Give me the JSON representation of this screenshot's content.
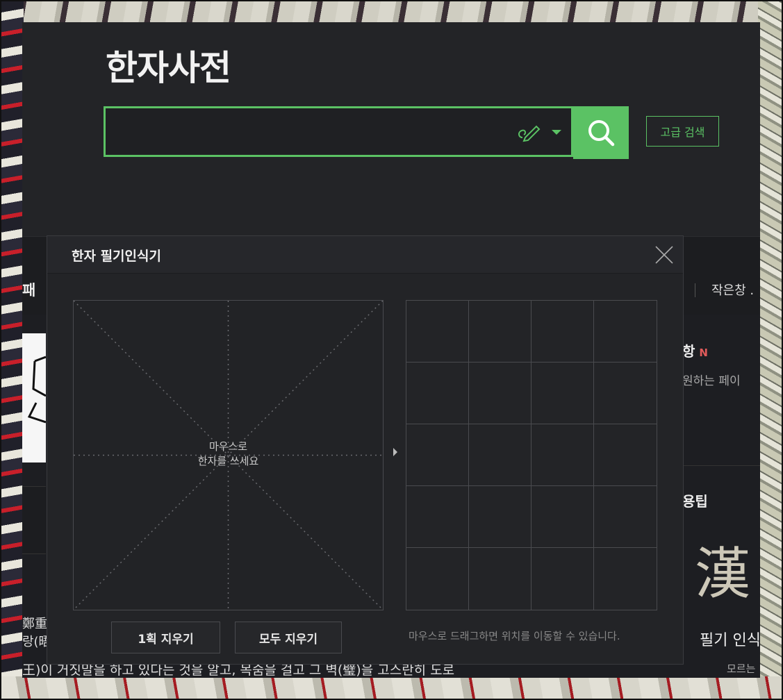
{
  "header": {
    "logo": "한자사전",
    "search": {
      "value": "",
      "placeholder": ""
    },
    "advanced_search_label": "고급 검색"
  },
  "nav": {
    "left_partial": "패",
    "small_window": "작은창 ."
  },
  "sidebar": {
    "notice_title": "항",
    "notice_badge": "N",
    "notice_text": "원하는 페이",
    "tips_title": "용팁",
    "big_hanja": "漢",
    "handwriting_title": "필기 인식",
    "handwriting_sub": "모르는"
  },
  "article": {
    "line1": "鄭重",
    "line2": "랑(晤",
    "line3": "王)이 거짓말을 하고 있다는 것을 알고, 목숨을 걸고 그 벽(璧)을 고스란히 도로"
  },
  "dialog": {
    "title": "한자 필기인식기",
    "pad_hint_line1": "마우스로",
    "pad_hint_line2": "한자를 쓰세요",
    "undo_label": "1획 지우기",
    "clear_label": "모두 지우기",
    "drag_hint": "마우스로 드래그하면 위치를 이동할 수 있습니다.",
    "result_cells": 20
  },
  "colors": {
    "accent": "#5bc264",
    "background": "#1d1e22",
    "badge": "#e25b5b"
  }
}
